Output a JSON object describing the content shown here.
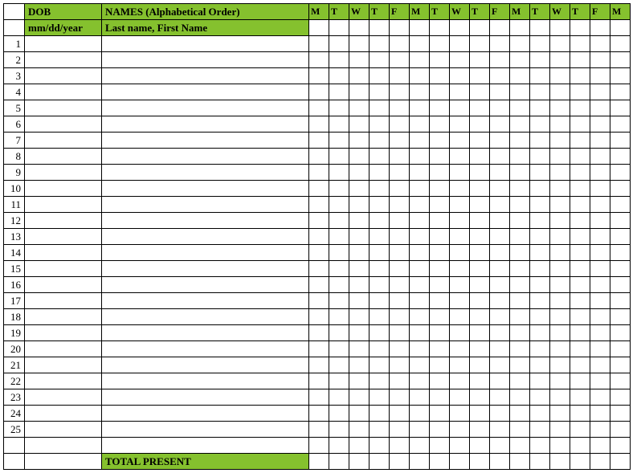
{
  "header": {
    "dob": "DOB",
    "names": "NAMES (Alphabetical Order)",
    "days": [
      "M",
      "T",
      "W",
      "T",
      "F",
      "M",
      "T",
      "W",
      "T",
      "F",
      "M",
      "T",
      "W",
      "T",
      "F",
      "M"
    ]
  },
  "subheader": {
    "dob": "mm/dd/year",
    "names": "Last name, First Name"
  },
  "rows": [
    {
      "n": "1"
    },
    {
      "n": "2"
    },
    {
      "n": "3"
    },
    {
      "n": "4"
    },
    {
      "n": "5"
    },
    {
      "n": "6"
    },
    {
      "n": "7"
    },
    {
      "n": "8"
    },
    {
      "n": "9"
    },
    {
      "n": "10"
    },
    {
      "n": "11"
    },
    {
      "n": "12"
    },
    {
      "n": "13"
    },
    {
      "n": "14"
    },
    {
      "n": "15"
    },
    {
      "n": "16"
    },
    {
      "n": "17"
    },
    {
      "n": "18"
    },
    {
      "n": "19"
    },
    {
      "n": "20"
    },
    {
      "n": "21"
    },
    {
      "n": "22"
    },
    {
      "n": "23"
    },
    {
      "n": "24"
    },
    {
      "n": "25"
    }
  ],
  "spacer_after_rows": true,
  "footer": {
    "total_present": "TOTAL PRESENT"
  }
}
